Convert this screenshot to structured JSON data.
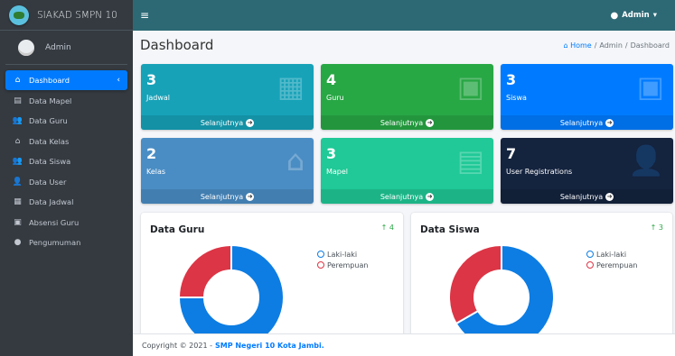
{
  "brand": {
    "name": "SIAKAD SMPN 10"
  },
  "user": {
    "name": "Admin"
  },
  "sidebar": {
    "items": [
      {
        "label": "Dashboard",
        "icon": "dashboard-icon",
        "glyph": "⌂",
        "active": true
      },
      {
        "label": "Data Mapel",
        "icon": "book-icon",
        "glyph": "▤"
      },
      {
        "label": "Data Guru",
        "icon": "users-icon",
        "glyph": "👥"
      },
      {
        "label": "Data Kelas",
        "icon": "home-icon",
        "glyph": "⌂"
      },
      {
        "label": "Data Siswa",
        "icon": "users-icon",
        "glyph": "👥"
      },
      {
        "label": "Data User",
        "icon": "user-plus-icon",
        "glyph": "👤"
      },
      {
        "label": "Data Jadwal",
        "icon": "calendar-icon",
        "glyph": "▦"
      },
      {
        "label": "Absensi Guru",
        "icon": "calendar-check-icon",
        "glyph": "▣"
      },
      {
        "label": "Pengumuman",
        "icon": "info-icon",
        "glyph": "●"
      }
    ]
  },
  "topbar": {
    "menu_glyph": "≡",
    "admin_label": "Admin",
    "admin_caret": "▾"
  },
  "header": {
    "title": "Dashboard",
    "breadcrumb": {
      "home": "Home",
      "sep": "/",
      "admin": "Admin",
      "current": "Dashboard"
    }
  },
  "boxes": [
    {
      "number": "3",
      "label": "Jadwal",
      "footer": "Selanjutnya",
      "color": "#17a2b8",
      "icon": "calendar-icon"
    },
    {
      "number": "4",
      "label": "Guru",
      "footer": "Selanjutnya",
      "color": "#28a745",
      "icon": "id-card-icon"
    },
    {
      "number": "3",
      "label": "Siswa",
      "footer": "Selanjutnya",
      "color": "#007bff",
      "icon": "id-card-icon"
    },
    {
      "number": "2",
      "label": "Kelas",
      "footer": "Selanjutnya",
      "color": "#4a8dc4",
      "icon": "home-icon"
    },
    {
      "number": "3",
      "label": "Mapel",
      "footer": "Selanjutnya",
      "color": "#20c997",
      "icon": "book-icon"
    },
    {
      "number": "7",
      "label": "User Registrations",
      "footer": "Selanjutnya",
      "color": "#14233e",
      "icon": "user-plus-icon"
    }
  ],
  "cards": {
    "guru": {
      "title": "Data Guru",
      "stat": "4",
      "legend": [
        "Laki-laki",
        "Perempuan"
      ],
      "chart_data": {
        "type": "pie",
        "labels": [
          "Laki-laki",
          "Perempuan"
        ],
        "values": [
          3,
          1
        ],
        "colors": [
          "#0d7de3",
          "#dc3545"
        ]
      }
    },
    "siswa": {
      "title": "Data Siswa",
      "stat": "3",
      "legend": [
        "Laki-laki",
        "Perempuan"
      ],
      "chart_data": {
        "type": "pie",
        "labels": [
          "Laki-laki",
          "Perempuan"
        ],
        "values": [
          2,
          1
        ],
        "colors": [
          "#0d7de3",
          "#dc3545"
        ]
      }
    }
  },
  "footer": {
    "copyright": "Copyright © 2021 -",
    "link": "SMP Negeri 10 Kota Jambi."
  }
}
